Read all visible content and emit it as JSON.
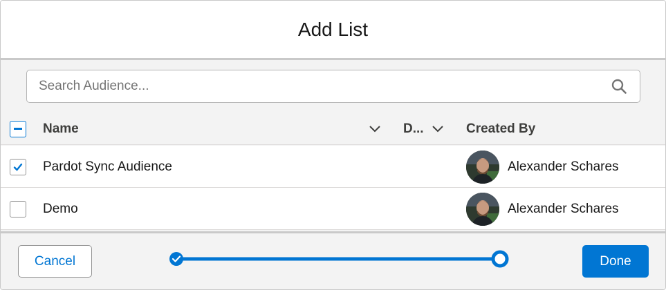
{
  "modal": {
    "title": "Add List"
  },
  "search": {
    "placeholder": "Search Audience..."
  },
  "table": {
    "columns": [
      {
        "label": "Name"
      },
      {
        "label": "D..."
      },
      {
        "label": "Created By"
      }
    ],
    "rows": [
      {
        "checked": true,
        "name": "Pardot Sync Audience",
        "created_by": "Alexander Schares"
      },
      {
        "checked": false,
        "name": "Demo",
        "created_by": "Alexander Schares"
      }
    ]
  },
  "footer": {
    "cancel_label": "Cancel",
    "done_label": "Done",
    "progress": {
      "total_steps": 2,
      "completed_steps": 1,
      "current_step": 2
    }
  },
  "colors": {
    "brand": "#0176d3",
    "border": "#c9c9c9",
    "background": "#f3f3f3"
  }
}
